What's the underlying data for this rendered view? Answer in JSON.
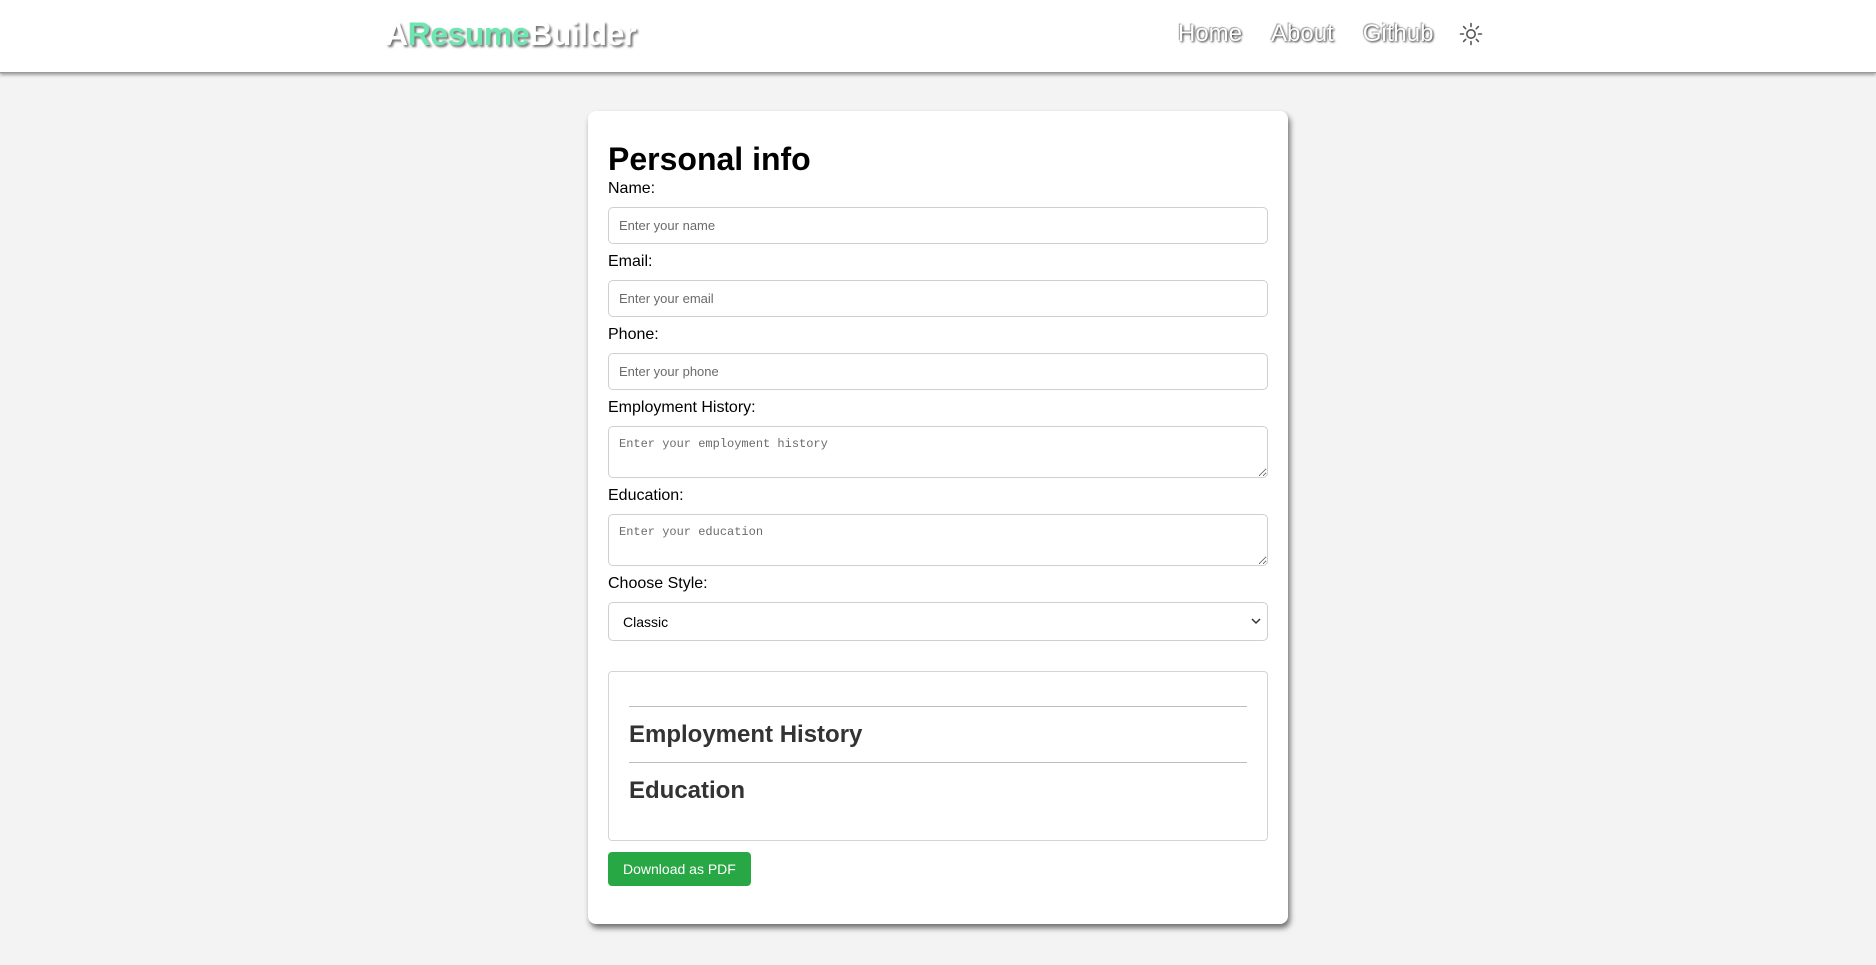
{
  "header": {
    "logo": {
      "part1": "A",
      "part2": "Resume",
      "part3": "Builder"
    },
    "nav": [
      {
        "label": "Home"
      },
      {
        "label": "About"
      },
      {
        "label": "Github"
      }
    ],
    "theme_toggle_icon": "sun-icon"
  },
  "form": {
    "title": "Personal info",
    "name": {
      "label": "Name:",
      "placeholder": "Enter your name",
      "value": ""
    },
    "email": {
      "label": "Email:",
      "placeholder": "Enter your email",
      "value": ""
    },
    "phone": {
      "label": "Phone:",
      "placeholder": "Enter your phone",
      "value": ""
    },
    "employment": {
      "label": "Employment History:",
      "placeholder": "Enter your employment history",
      "value": ""
    },
    "education": {
      "label": "Education:",
      "placeholder": "Enter your education",
      "value": ""
    },
    "style": {
      "label": "Choose Style:",
      "selected": "Classic"
    }
  },
  "preview": {
    "employment_heading": "Employment History",
    "education_heading": "Education"
  },
  "actions": {
    "download_label": "Download as PDF"
  },
  "colors": {
    "logo_accent": "#6ee6b0",
    "button": "#28a745",
    "background": "#f3f3f3"
  }
}
